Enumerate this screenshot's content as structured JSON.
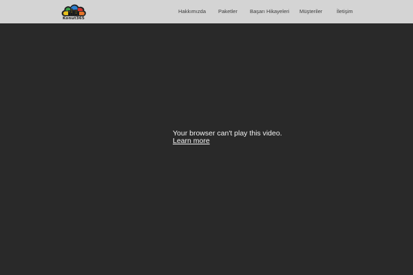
{
  "header": {
    "logo_text": "Konut365",
    "nav": [
      {
        "label": "Hakkımızda"
      },
      {
        "label": "Paketler"
      },
      {
        "label": "Başarı Hikayeleri"
      },
      {
        "label": "Müşteriler"
      },
      {
        "label": "İletişim"
      }
    ]
  },
  "video": {
    "message": "Your browser can't play this video.",
    "link_label": "Learn more"
  },
  "colors": {
    "header_bg": "#d4d4d4",
    "video_bg": "#292929",
    "nav_text": "#3d3d3d",
    "video_text": "#f4f4f4"
  }
}
